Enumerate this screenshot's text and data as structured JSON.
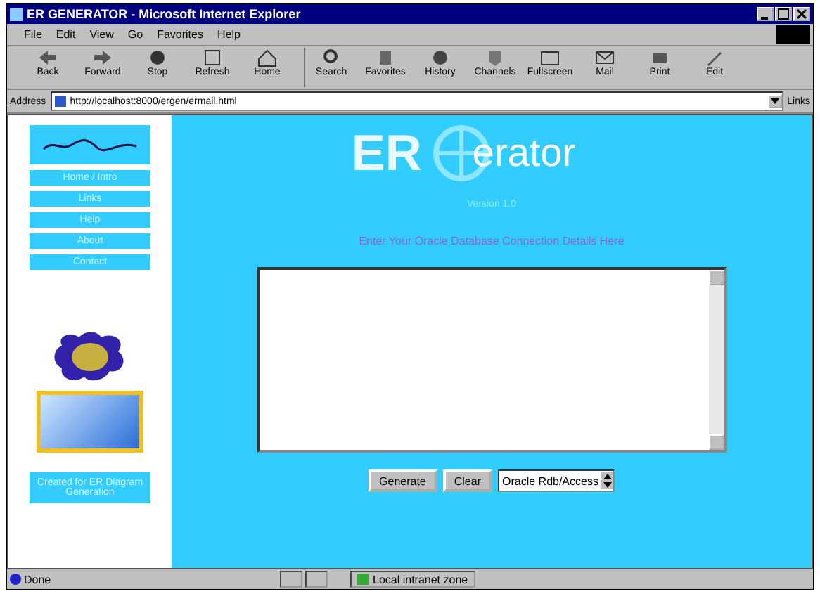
{
  "window": {
    "title": "ER GENERATOR - Microsoft Internet Explorer"
  },
  "menu": [
    "File",
    "Edit",
    "View",
    "Go",
    "Favorites",
    "Help"
  ],
  "toolbar": [
    {
      "label": "Back",
      "kind": "back"
    },
    {
      "label": "Forward",
      "kind": "forward"
    },
    {
      "label": "Stop",
      "kind": "stop"
    },
    {
      "label": "Refresh",
      "kind": "refresh"
    },
    {
      "label": "Home",
      "kind": "home"
    },
    {
      "label": "Search",
      "kind": "search"
    },
    {
      "label": "Favorites",
      "kind": "favorites"
    },
    {
      "label": "History",
      "kind": "history"
    },
    {
      "label": "Channels",
      "kind": "channels"
    },
    {
      "label": "Fullscreen",
      "kind": "fullscreen"
    },
    {
      "label": "Mail",
      "kind": "mail"
    },
    {
      "label": "Print",
      "kind": "print"
    },
    {
      "label": "Edit",
      "kind": "edit"
    }
  ],
  "address": {
    "label": "Address",
    "value": "http://localhost:8000/ergen/ermail.html",
    "links": "Links"
  },
  "sidebar": {
    "items": [
      "Home / Intro",
      "Links",
      "Help",
      "About",
      "Contact"
    ],
    "footer": "Created for ER Diagram Generation"
  },
  "main": {
    "logo_left": "ER",
    "logo_right": "erator",
    "version": "Version 1.0",
    "prompt": "Enter Your Oracle Database Connection Details Here",
    "buttons": [
      "Generate",
      "Clear"
    ],
    "select": "Oracle Rdb/Access"
  },
  "status_bar": {
    "text": "Done",
    "zone": "Local intranet zone"
  }
}
